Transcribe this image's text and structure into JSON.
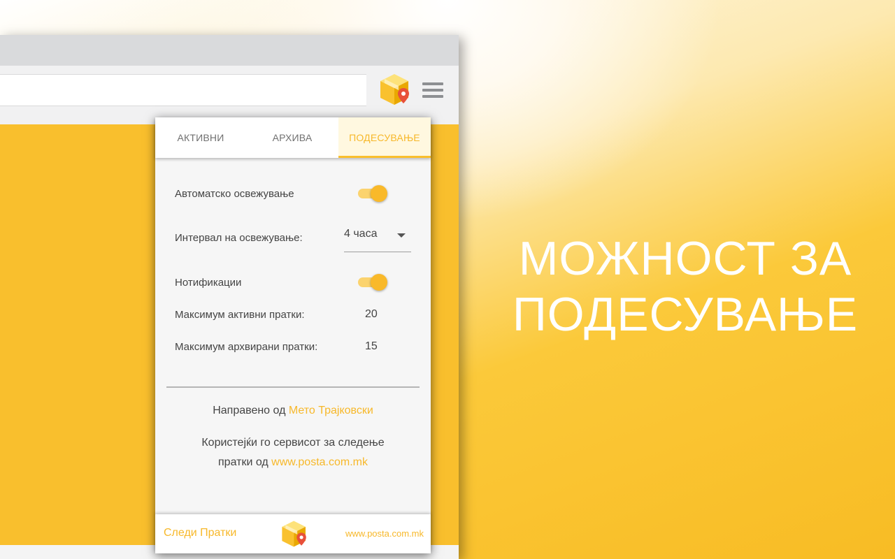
{
  "browser": {
    "extension_icon": "package-location-icon",
    "menu_icon": "hamburger-menu-icon"
  },
  "popup": {
    "tabs": [
      {
        "label": "АКТИВНИ",
        "active": false
      },
      {
        "label": "АРХИВА",
        "active": false
      },
      {
        "label": "ПОДЕСУВАЊЕ",
        "active": true
      }
    ],
    "settings": {
      "auto_refresh_label": "Автоматско освежување",
      "auto_refresh_on": true,
      "interval_label": "Интервал на освежување:",
      "interval_value": "4 часа",
      "notifications_label": "Нотификации",
      "notifications_on": true,
      "max_active_label": "Максимум активни пратки:",
      "max_active_value": "20",
      "max_archived_label": "Максимум архвирани пратки:",
      "max_archived_value": "15"
    },
    "credits": {
      "made_by_prefix": "Направено од",
      "author": "Мето Трајковски",
      "service_line1": "Користејќи го сервисот за следење",
      "service_line2_prefix": "пратки од",
      "service_link": "www.posta.com.mk"
    },
    "footer": {
      "brand": "Следи Пратки",
      "site": "www.posta.com.mk",
      "logo_icon": "package-location-icon"
    }
  },
  "headline": {
    "line1": "МОЖНОСТ ЗА",
    "line2": "ПОДЕСУВАЊЕ"
  },
  "colors": {
    "accent": "#f9bf2d",
    "link": "#f7b82a"
  }
}
